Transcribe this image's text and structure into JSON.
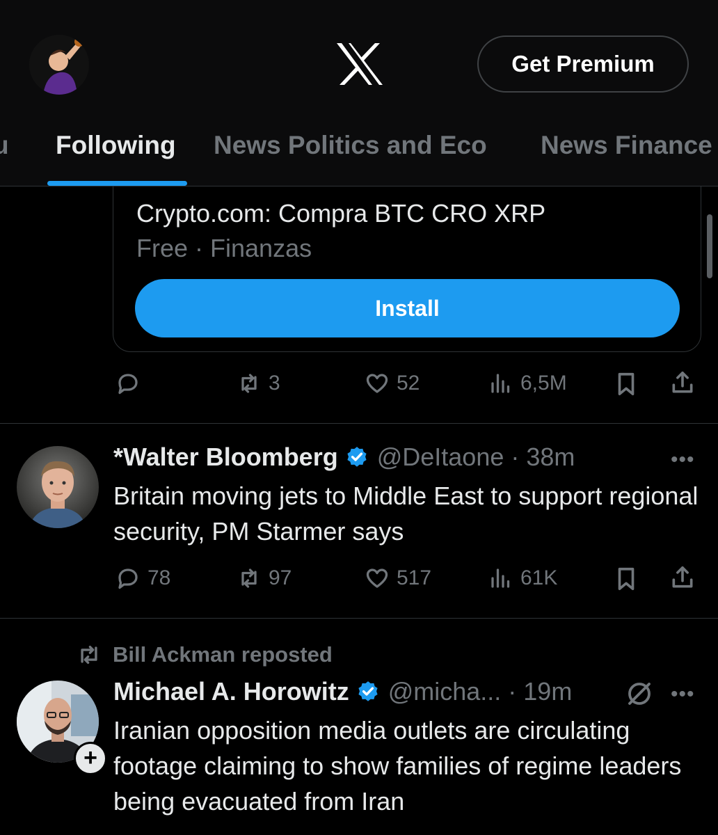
{
  "header": {
    "premium_label": "Get Premium"
  },
  "tabs": [
    {
      "label": "u"
    },
    {
      "label": "Following"
    },
    {
      "label": "News Politics and Eco"
    },
    {
      "label": "News Finance"
    }
  ],
  "ad": {
    "title": "Crypto.com: Compra BTC CRO XRP",
    "subtitle": "Free · Finanzas",
    "install_label": "Install",
    "actions": {
      "reposts": "3",
      "likes": "52",
      "views": "6,5M"
    }
  },
  "posts": [
    {
      "name": "*Walter Bloomberg",
      "handle": "@DeItaone · 38m",
      "text": "Britain moving jets to Middle East to support regional security, PM Starmer says",
      "replies": "78",
      "reposts": "97",
      "likes": "517",
      "views": "61K",
      "more": "•••"
    },
    {
      "repost_label": "Bill Ackman reposted",
      "name": "Michael A. Horowitz",
      "handle": "@micha... · 19m",
      "text": "Iranian opposition media outlets are circulating footage claiming to show families of regime leaders being evacuated from Iran",
      "more": "•••",
      "follow_symbol": "+"
    }
  ],
  "colors": {
    "accent": "#1d9bf0",
    "background": "#000000",
    "muted": "#71767b",
    "text": "#e7e9ea"
  }
}
